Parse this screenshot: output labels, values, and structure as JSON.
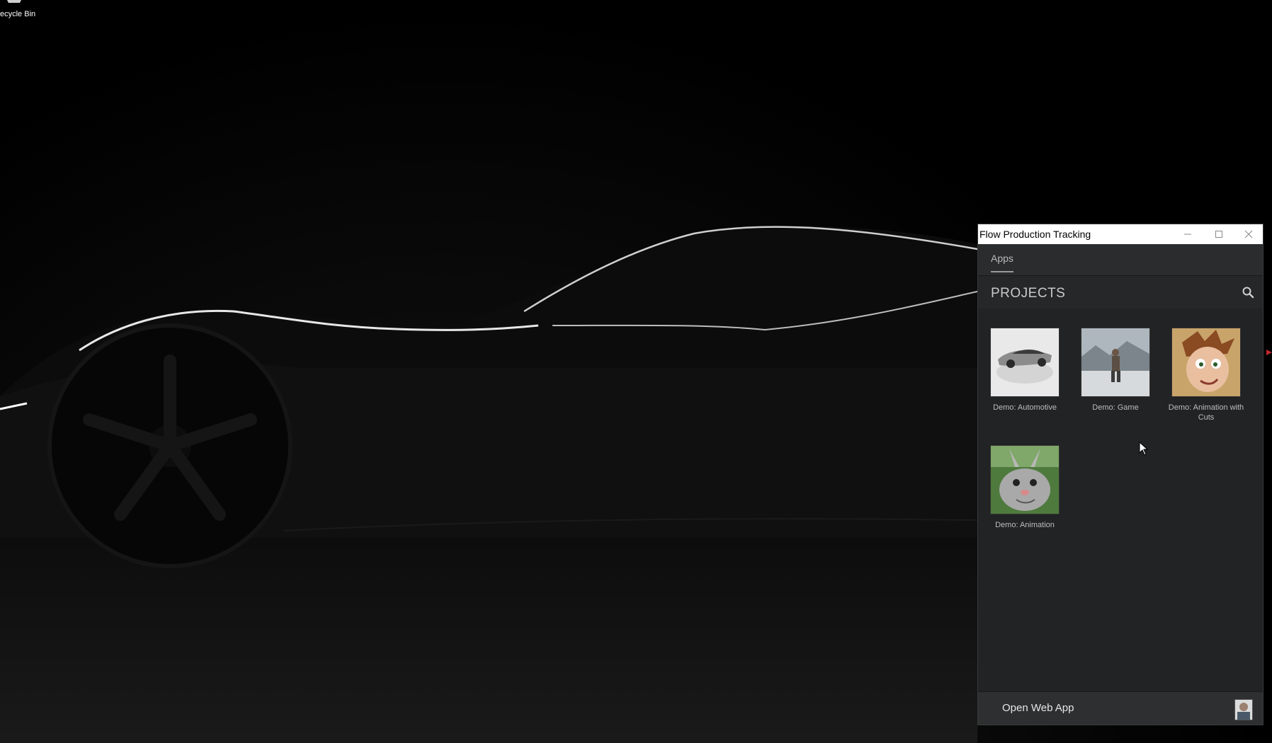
{
  "desktop": {
    "recycle_bin_label": "ecycle Bin",
    "recycle_bin_icon": "recycle-bin-icon"
  },
  "window": {
    "title": "Flow Production Tracking",
    "controls": {
      "minimize": "minimize-icon",
      "maximize": "maximize-icon",
      "close": "close-icon"
    },
    "tabs": [
      {
        "label": "Apps",
        "active": true
      }
    ],
    "section_title": "PROJECTS",
    "search_icon": "search-icon",
    "projects": [
      {
        "name": "Demo: Automotive"
      },
      {
        "name": "Demo: Game"
      },
      {
        "name": "Demo: Animation with Cuts"
      },
      {
        "name": "Demo: Animation"
      }
    ],
    "footer": {
      "open_web_app_label": "Open Web App"
    }
  },
  "colors": {
    "window_bg": "#222324",
    "titlebar_bg": "#ffffff",
    "text_light": "#c9c9c9",
    "accent_marker": "#c0272d"
  }
}
